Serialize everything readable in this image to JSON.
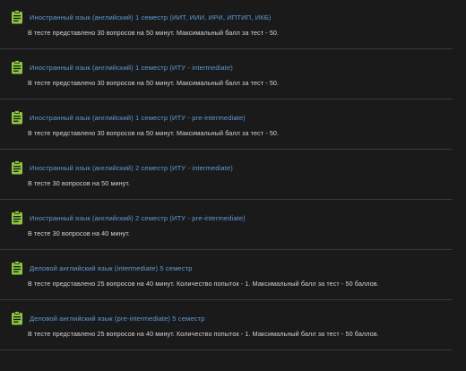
{
  "quizzes": [
    {
      "icon": "quiz-icon",
      "title": "Иностранный язык (английский) 1 семестр (ИИТ, ИИИ, ИРИ, ИПТИП, ИКБ)",
      "description": "В тесте представлено 30 вопросов на 50 минут. Максимальный балл за тест - 50."
    },
    {
      "icon": "quiz-icon",
      "title": "Иностранный язык (английский) 1 семестр (ИТУ - intermediate)",
      "description": "В тесте представлено 30 вопросов на 50 минут. Максимальный балл за тест - 50."
    },
    {
      "icon": "quiz-icon",
      "title": "Иностранный язык (английский) 1 семестр (ИТУ - pre-intermediate)",
      "description": "В тесте представлено 30 вопросов на 50 минут. Максимальный балл за тест - 50."
    },
    {
      "icon": "quiz-icon",
      "title": "Иностранный язык (английский) 2 семестр (ИТУ - intermediate)",
      "description": "В тесте 30 вопросов на 50 минут."
    },
    {
      "icon": "quiz-icon",
      "title": "Иностранный язык (английский) 2 семестр (ИТУ - pre-intermediate)",
      "description": "В тесте 30 вопросов на 40 минут."
    },
    {
      "icon": "quiz-icon",
      "title": "Деловой английский язык (intermediate) 5 семестр",
      "description": "В тесте представлено 25 вопросов на 40 минут. Количество попыток - 1. Максимальный балл за тест - 50 баллов."
    },
    {
      "icon": "quiz-icon",
      "title": "Деловой английский язык (pre-intermediate) 5 семестр",
      "description": "В тесте представлено 25 вопросов на 40 минут. Количество попыток - 1. Максимальный балл за тест - 50 баллов."
    }
  ],
  "colors": {
    "background": "#1a1a1b",
    "link": "#5b9bd5",
    "icon": "#8cc63f",
    "divider": "#3a3a3c",
    "text": "#d4d4d4"
  }
}
